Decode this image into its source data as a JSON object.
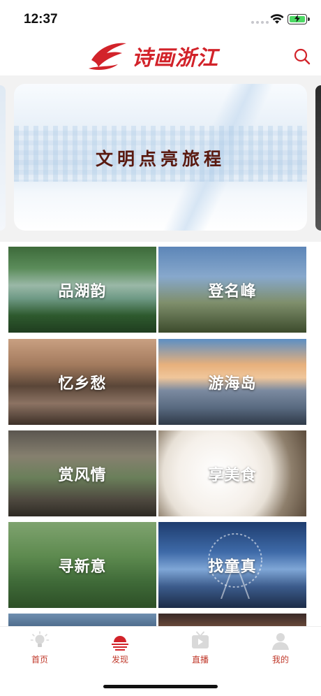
{
  "status": {
    "time": "12:37"
  },
  "header": {
    "app_name": "诗画浙江",
    "brand_color": "#d2232a",
    "search_icon": "search-icon"
  },
  "banner": {
    "title": "文明点亮旅程"
  },
  "tiles": [
    {
      "label": "品湖韵"
    },
    {
      "label": "登名峰"
    },
    {
      "label": "忆乡愁"
    },
    {
      "label": "游海岛"
    },
    {
      "label": "赏风情"
    },
    {
      "label": "享美食"
    },
    {
      "label": "寻新意"
    },
    {
      "label": "找童真"
    }
  ],
  "tabbar": {
    "active_color": "#c0392b",
    "items": [
      {
        "label": "首页",
        "icon": "lightbulb-icon"
      },
      {
        "label": "发现",
        "icon": "sunrise-icon"
      },
      {
        "label": "直播",
        "icon": "tv-play-icon"
      },
      {
        "label": "我的",
        "icon": "person-icon"
      }
    ]
  }
}
